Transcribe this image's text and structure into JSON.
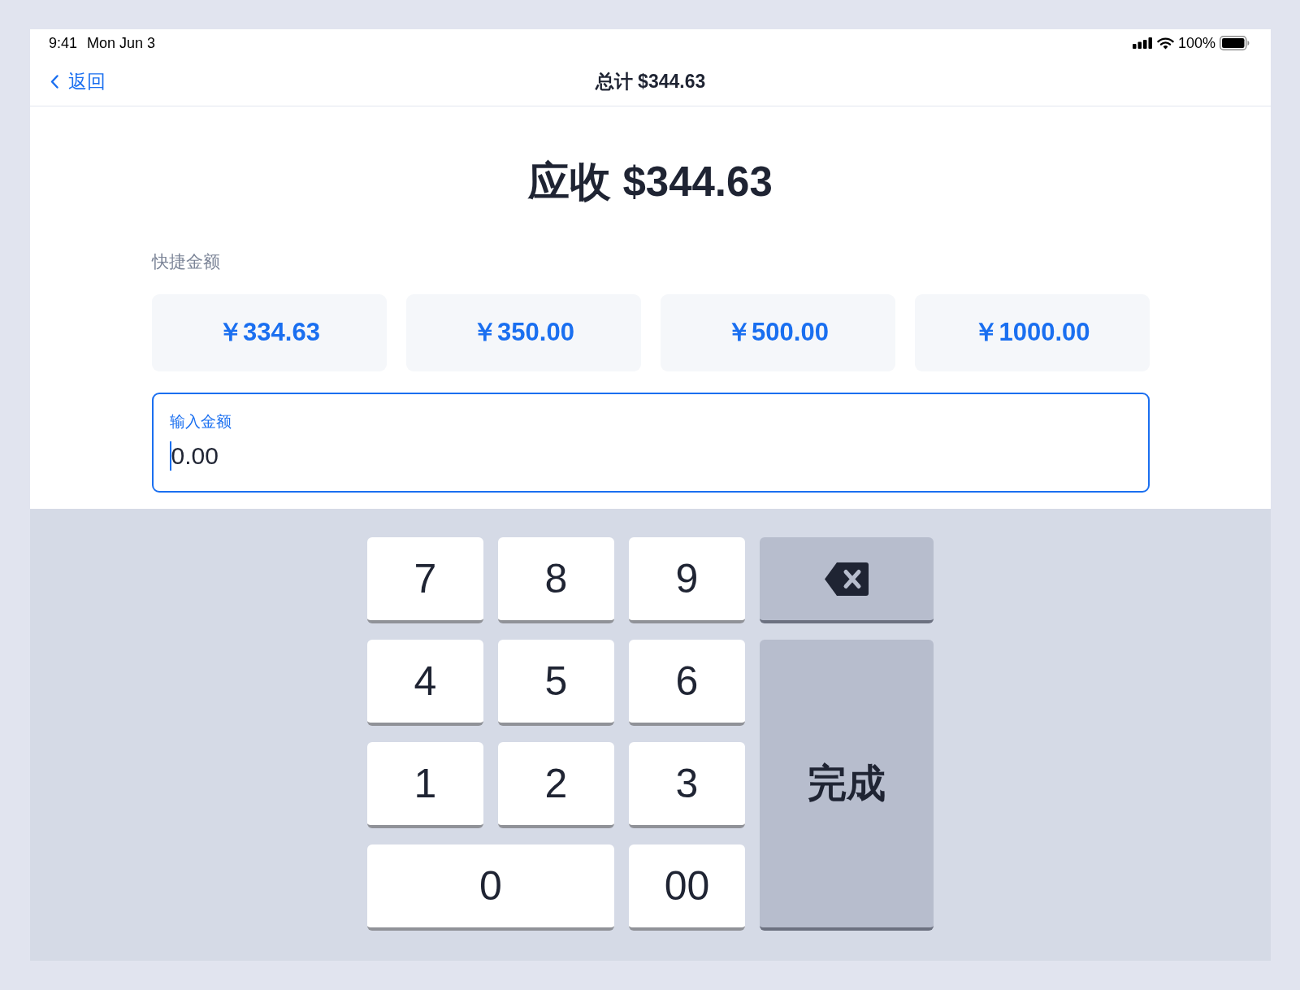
{
  "status_bar": {
    "time": "9:41",
    "date": "Mon Jun 3",
    "battery": "100%"
  },
  "nav_bar": {
    "back_label": "返回",
    "title": "总计 $344.63"
  },
  "amount_due": "应收 $344.63",
  "quick_amounts": {
    "label": "快捷金额",
    "options": [
      "￥334.63",
      "￥350.00",
      "￥500.00",
      "￥1000.00"
    ]
  },
  "amount_input": {
    "label": "输入金额",
    "value": "0.00",
    "focused": true
  },
  "keypad": {
    "keys": [
      {
        "kind": "digit",
        "label": "7",
        "wide": false
      },
      {
        "kind": "digit",
        "label": "8",
        "wide": false
      },
      {
        "kind": "digit",
        "label": "9",
        "wide": false
      },
      {
        "kind": "backspace",
        "wide": false
      },
      {
        "kind": "digit",
        "label": "4",
        "wide": false
      },
      {
        "kind": "digit",
        "label": "5",
        "wide": false
      },
      {
        "kind": "digit",
        "label": "6",
        "wide": false
      },
      {
        "kind": "digit",
        "label": "1",
        "wide": false
      },
      {
        "kind": "digit",
        "label": "2",
        "wide": false
      },
      {
        "kind": "digit",
        "label": "3",
        "wide": false
      },
      {
        "kind": "done",
        "label": "完成",
        "wide": false
      },
      {
        "kind": "digit",
        "label": "0",
        "wide": true
      },
      {
        "kind": "digit",
        "label": "00",
        "wide": false
      }
    ]
  }
}
